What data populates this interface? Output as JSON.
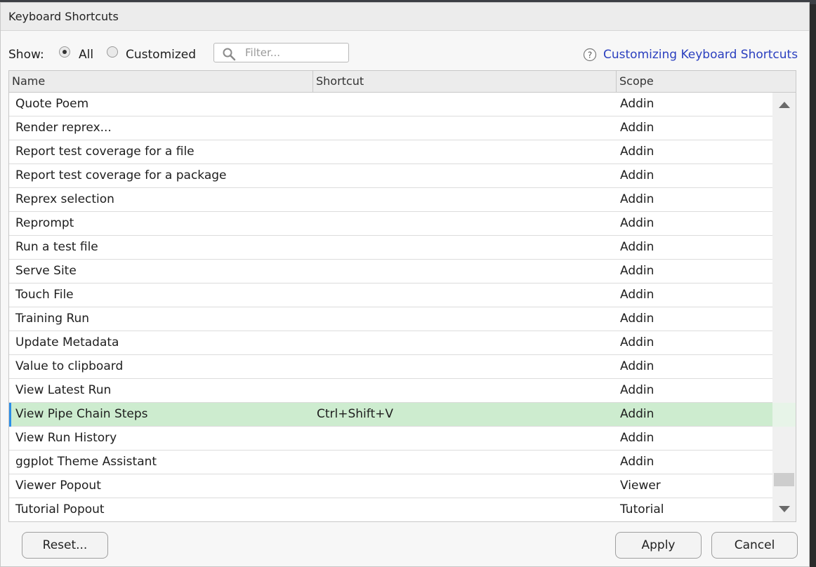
{
  "dialog": {
    "title": "Keyboard Shortcuts"
  },
  "toolbar": {
    "show_label": "Show:",
    "radio_all": "All",
    "radio_customized": "Customized",
    "selected_filter": "All",
    "filter_placeholder": "Filter...",
    "help_link": "Customizing Keyboard Shortcuts"
  },
  "table": {
    "columns": [
      "Name",
      "Shortcut",
      "Scope"
    ],
    "rows": [
      {
        "name": "Quote Poem",
        "shortcut": "",
        "scope": "Addin"
      },
      {
        "name": "Render reprex...",
        "shortcut": "",
        "scope": "Addin"
      },
      {
        "name": "Report test coverage for a file",
        "shortcut": "",
        "scope": "Addin"
      },
      {
        "name": "Report test coverage for a package",
        "shortcut": "",
        "scope": "Addin"
      },
      {
        "name": "Reprex selection",
        "shortcut": "",
        "scope": "Addin"
      },
      {
        "name": "Reprompt",
        "shortcut": "",
        "scope": "Addin"
      },
      {
        "name": "Run a test file",
        "shortcut": "",
        "scope": "Addin"
      },
      {
        "name": "Serve Site",
        "shortcut": "",
        "scope": "Addin"
      },
      {
        "name": "Touch File",
        "shortcut": "",
        "scope": "Addin"
      },
      {
        "name": "Training Run",
        "shortcut": "",
        "scope": "Addin"
      },
      {
        "name": "Update Metadata",
        "shortcut": "",
        "scope": "Addin"
      },
      {
        "name": "Value to clipboard",
        "shortcut": "",
        "scope": "Addin"
      },
      {
        "name": "View Latest Run",
        "shortcut": "",
        "scope": "Addin"
      },
      {
        "name": "View Pipe Chain Steps",
        "shortcut": "Ctrl+Shift+V",
        "scope": "Addin",
        "selected": true
      },
      {
        "name": "View Run History",
        "shortcut": "",
        "scope": "Addin"
      },
      {
        "name": "ggplot Theme Assistant",
        "shortcut": "",
        "scope": "Addin"
      },
      {
        "name": "Viewer Popout",
        "shortcut": "",
        "scope": "Viewer"
      },
      {
        "name": "Tutorial Popout",
        "shortcut": "",
        "scope": "Tutorial"
      }
    ]
  },
  "buttons": {
    "reset": "Reset...",
    "apply": "Apply",
    "cancel": "Cancel"
  },
  "colors": {
    "selected_row": "#cdeccf",
    "selected_marker": "#2b8ee8",
    "link": "#2a3fbf"
  },
  "icons": {
    "filter": "search-icon",
    "help": "help-circle-icon"
  }
}
